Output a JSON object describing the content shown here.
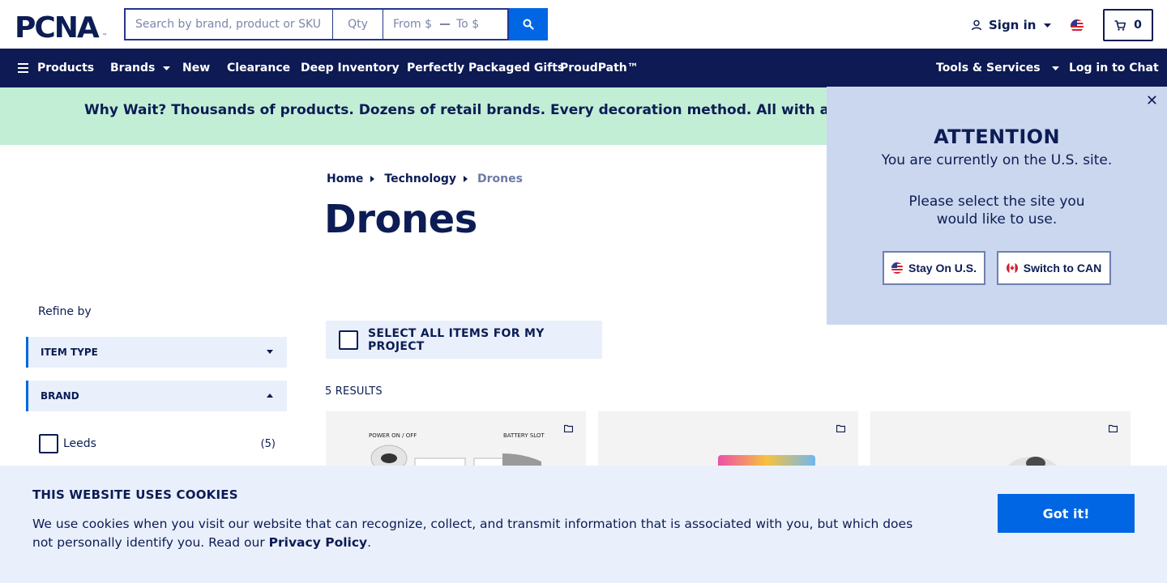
{
  "header": {
    "logo_text": "PCNA",
    "search": {
      "placeholder": "Search by brand, product or SKU"
    },
    "qty": {
      "placeholder": "Qty"
    },
    "price": {
      "from_label": "From $",
      "to_label": "To $"
    },
    "signin_label": "Sign in",
    "cart_count": "0",
    "icons": [
      "search-icon",
      "user-icon",
      "chevron-down-icon",
      "us-flag-icon",
      "cart-icon"
    ]
  },
  "nav": {
    "products": "Products",
    "brands": "Brands",
    "new": "New",
    "clearance": "Clearance",
    "deep_inventory": "Deep Inventory",
    "gifts": "Perfectly Packaged Gifts",
    "proudpath": "ProudPath™",
    "tools": "Tools & Services",
    "chat": "Log in to Chat"
  },
  "banner": {
    "text": "Why Wait? Thousands of products. Dozens of retail brands. Every decoration method. All with a standard"
  },
  "breadcrumb": {
    "items": [
      "Home",
      "Technology",
      "Drones"
    ]
  },
  "page": {
    "title": "Drones",
    "results_label": "5 RESULTS",
    "select_all_label": "SELECT ALL ITEMS FOR MY PROJECT"
  },
  "filters": {
    "refine_label": "Refine by",
    "item_type": "ITEM TYPE",
    "brand": "BRAND",
    "options": [
      {
        "label": "Leeds",
        "count": "(5)"
      }
    ]
  },
  "product_images": {
    "card1_labels": [
      "POWER ON / OFF",
      "BATTERY SLOT"
    ]
  },
  "attention": {
    "title": "ATTENTION",
    "line1": "You are currently on the U.S. site.",
    "line2": "Please select the site you would like to use.",
    "stay_label": "Stay On U.S.",
    "switch_label": "Switch to CAN"
  },
  "cookie": {
    "title": "THIS WEBSITE USES COOKIES",
    "text": "We use cookies when you visit our website that can recognize, collect, and transmit information that is associated with you, but which does not personally identify you. Read our ",
    "link": "Privacy Policy",
    "end": ".",
    "button": "Got it!"
  },
  "colors": {
    "navy": "#0d1a53",
    "accent_blue": "#0066e4",
    "banner_green": "#c2eed6",
    "modal_bg": "#cbd7ee",
    "cookie_bg": "#eaf0fb"
  }
}
